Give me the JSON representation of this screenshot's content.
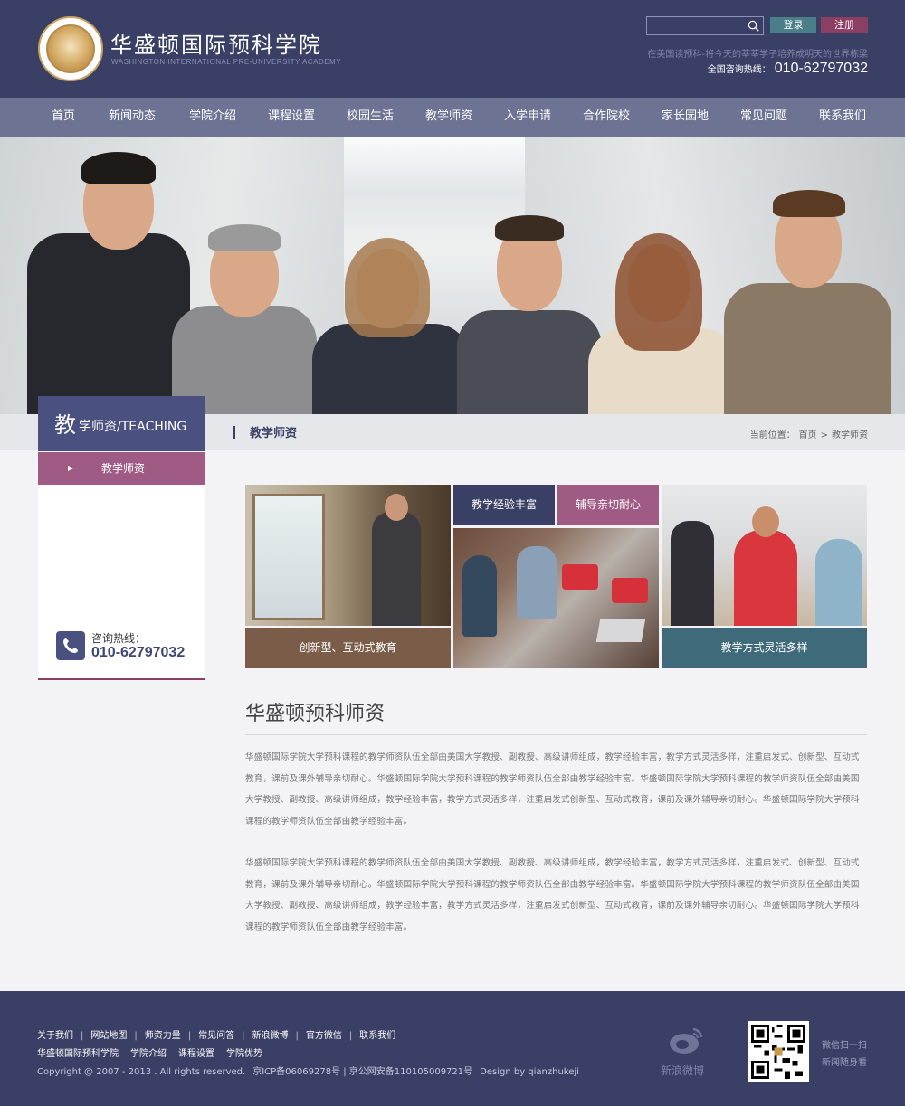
{
  "header": {
    "title": "华盛顿国际预科学院",
    "subtitle": "WASHINGTON INTERNATIONAL PRE-UNIVERSITY ACADEMY",
    "search_placeholder": "",
    "login": "登录",
    "register": "注册",
    "slogan": "在美国读预科-将今天的莘莘学子培养成明天的世界栋梁",
    "hotline_label": "全国咨询热线：",
    "hotline_number": "010-62797032"
  },
  "nav": [
    "首页",
    "新闻动态",
    "学院介绍",
    "课程设置",
    "校园生活",
    "教学师资",
    "入学申请",
    "合作院校",
    "家长园地",
    "常见问题",
    "联系我们"
  ],
  "sidebar": {
    "title_big": "教",
    "title_rest": "学师资/TEACHING",
    "menu_item": "教学师资",
    "hot_label": "咨询热线：",
    "hot_number": "010-62797032"
  },
  "section": {
    "title": "教学师资",
    "breadcrumb_label": "当前位置：",
    "breadcrumb_home": "首页",
    "breadcrumb_sep": ">",
    "breadcrumb_current": "教学师资"
  },
  "tiles": {
    "t1_label": "创新型、互动式教育",
    "t2_label": "教学经验丰富",
    "t3_label": "辅导亲切耐心",
    "t5_label": "教学方式灵活多样"
  },
  "article": {
    "title": "华盛顿预科师资",
    "para1": "华盛顿国际学院大学预科课程的教学师资队伍全部由美国大学教授、副教授、高级讲师组成，教学经验丰富，教学方式灵活多样，注重启发式、创新型、互动式教育，课前及课外辅导亲切耐心。华盛顿国际学院大学预科课程的教学师资队伍全部由教学经验丰富。华盛顿国际学院大学预科课程的教学师资队伍全部由美国大学教授、副教授、高级讲师组成，教学经验丰富，教学方式灵活多样，注重启发式创新型、互动式教育，课前及课外辅导亲切耐心。华盛顿国际学院大学预科课程的教学师资队伍全部由教学经验丰富。",
    "para2": "华盛顿国际学院大学预科课程的教学师资队伍全部由美国大学教授、副教授、高级讲师组成，教学经验丰富，教学方式灵活多样，注重启发式、创新型、互动式教育，课前及课外辅导亲切耐心。华盛顿国际学院大学预科课程的教学师资队伍全部由教学经验丰富。华盛顿国际学院大学预科课程的教学师资队伍全部由美国大学教授、副教授、高级讲师组成，教学经验丰富，教学方式灵活多样，注重启发式创新型、互动式教育，课前及课外辅导亲切耐心。华盛顿国际学院大学预科课程的教学师资队伍全部由教学经验丰富。"
  },
  "footer": {
    "links": [
      "关于我们",
      "网站地图",
      "师资力量",
      "常见问答",
      "新浪微博",
      "官方微信",
      "联系我们"
    ],
    "links2": [
      "华盛顿国际预科学院",
      "学院介绍",
      "课程设置",
      "学院优势"
    ],
    "copyright": "Copyright @ 2007 - 2013 . All rights reserved.",
    "icp": "京ICP备06069278号 | 京公网安备110105009721号",
    "design": "Design by qianzhukeji",
    "weibo_label": "新浪微博",
    "qr_line1": "微信扫一扫",
    "qr_line2": "新闻随身看"
  },
  "colors": {
    "header_bg": "#3a4065",
    "nav_bg": "#6c7393",
    "accent_purple": "#a05b84",
    "accent_teal": "#4a7f8a"
  }
}
